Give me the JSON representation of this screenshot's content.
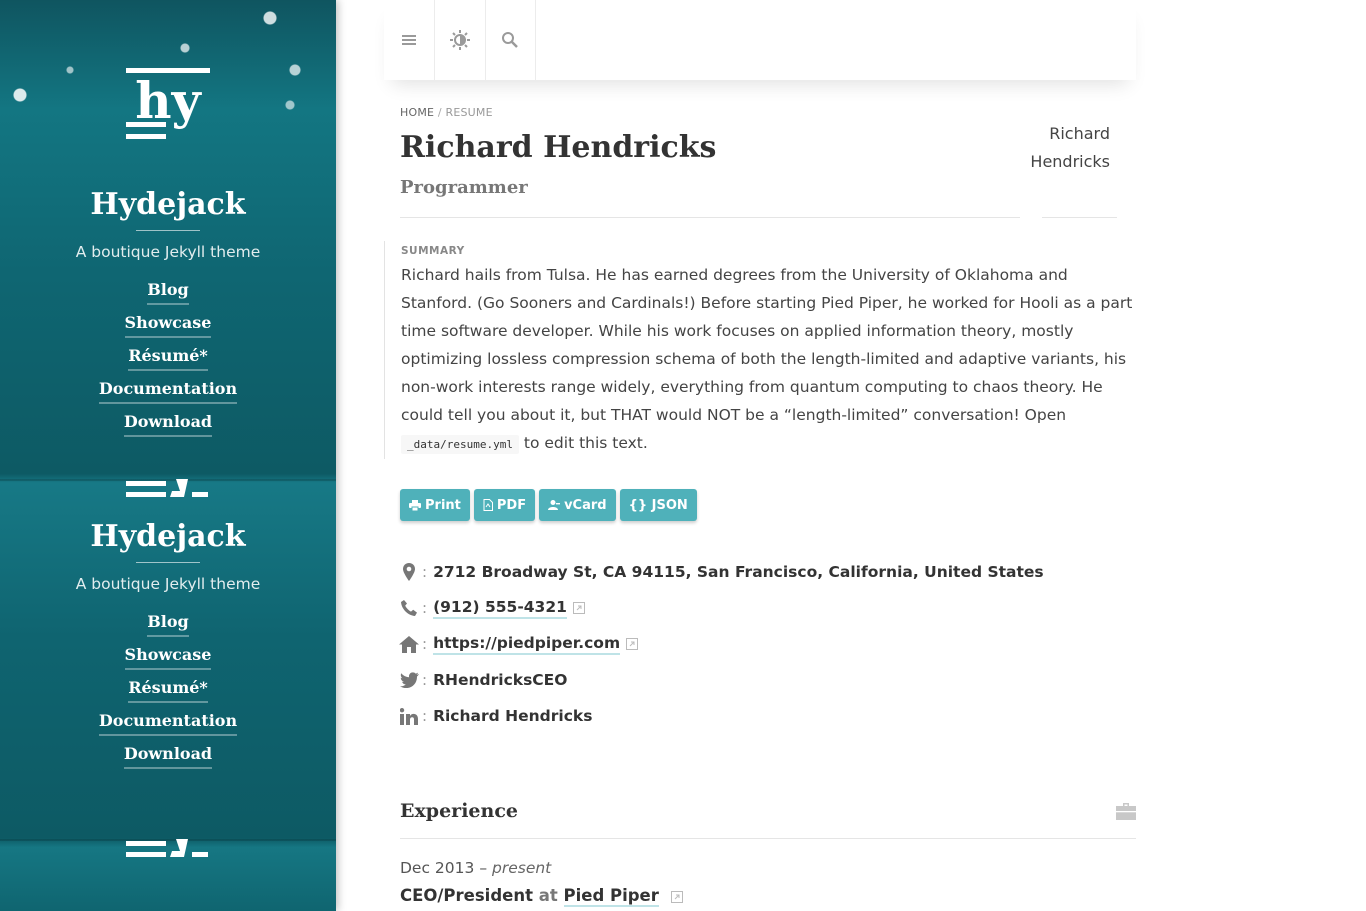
{
  "sidebar": {
    "title": "Hydejack",
    "tagline": "A boutique Jekyll theme",
    "nav": [
      {
        "label": "Blog"
      },
      {
        "label": "Showcase"
      },
      {
        "label": "Résumé*"
      },
      {
        "label": "Documentation"
      },
      {
        "label": "Download"
      }
    ]
  },
  "topbar": {
    "menu_icon": "menu-icon",
    "theme_icon": "brightness-icon",
    "search_icon": "search-icon"
  },
  "breadcrumb": {
    "home": "HOME",
    "separator": "/",
    "current": "RESUME"
  },
  "resume": {
    "name": "Richard Hendricks",
    "role": "Programmer",
    "photo_alt": "Richard Hendricks",
    "summary_label": "SUMMARY",
    "summary_before": "Richard hails from Tulsa. He has earned degrees from the University of Oklahoma and Stanford. (Go Sooners and Cardinals!) Before starting Pied Piper, he worked for Hooli as a part time software developer. While his work focuses on applied information theory, mostly optimizing lossless compression schema of both the length-limited and adaptive variants, his non-work interests range widely, everything from quantum computing to chaos theory. He could tell you about it, but THAT would NOT be a “length-limited” conversation! Open",
    "summary_code": "_data/resume.yml",
    "summary_after": "to edit this text."
  },
  "buttons": {
    "print": "Print",
    "pdf": "PDF",
    "vcard": "vCard",
    "json": "{} JSON"
  },
  "contact": {
    "colon": ":",
    "address": "2712 Broadway St, CA 94115, San Francisco, California, United States",
    "phone": "(912) 555-4321",
    "website": "https://piedpiper.com",
    "twitter": "RHendricksCEO",
    "linkedin": "Richard Hendricks"
  },
  "experience": {
    "heading": "Experience",
    "date_start": "Dec 2013",
    "date_sep": "–",
    "date_end": "present",
    "position": "CEO/President",
    "at": "at",
    "company": "Pied Piper"
  },
  "colors": {
    "accent": "#4fb1ba",
    "sidebar": "#0f6672"
  }
}
